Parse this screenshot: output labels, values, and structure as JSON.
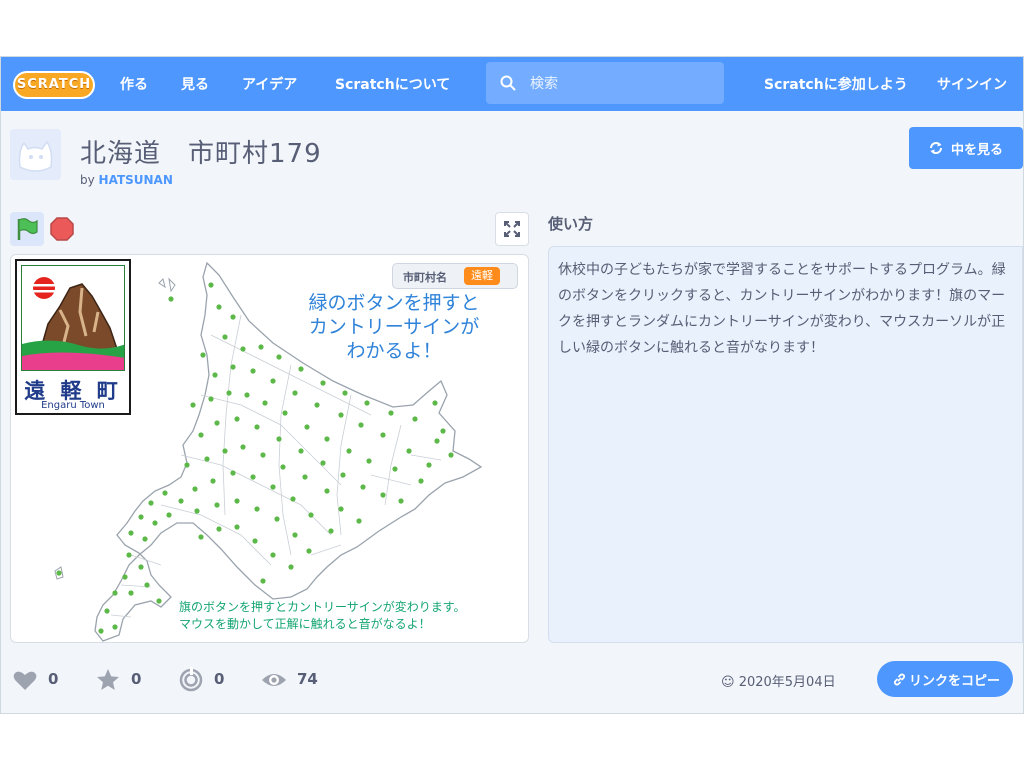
{
  "nav": {
    "logo": "SCRATCH",
    "items": [
      "作る",
      "見る",
      "アイデア",
      "Scratchについて"
    ],
    "search_placeholder": "検索",
    "join": "Scratchに参加しよう",
    "signin": "サインイン"
  },
  "project": {
    "title": "北海道　市町村179",
    "by_prefix": "by",
    "author": "HATSUNAN",
    "see_inside": "中を見る"
  },
  "stage": {
    "sign_kanji": "遠 軽 町",
    "sign_english": "Engaru Town",
    "muni_label": "市町村名",
    "muni_value": "遠軽",
    "hint_main": [
      "緑のボタンを押すと",
      "カントリーサインが",
      "わかるよ！"
    ],
    "hint_sub": [
      "旗のボタンを押すとカントリーサインが変わります。",
      "マウスを動かして正解に触れると音がなるよ！"
    ]
  },
  "instructions": {
    "title": "使い方",
    "body": "休校中の子どもたちが家で学習することをサポートするプログラム。緑のボタンをクリックすると、カントリーサインがわかります！旗のマークを押すとランダムにカントリーサインが変わり、マウスカーソルが正しい緑のボタンに触れると音がなります！"
  },
  "stats": {
    "loves": "0",
    "favorites": "0",
    "remixes": "0",
    "views": "74",
    "date": "2020年5月04日",
    "copy_link": "リンクをコピー"
  },
  "colors": {
    "brand": "#4d97ff",
    "logo": "#f9a826",
    "text": "#575e75",
    "dot": "#5cb848",
    "badge": "#ff8c1a"
  }
}
